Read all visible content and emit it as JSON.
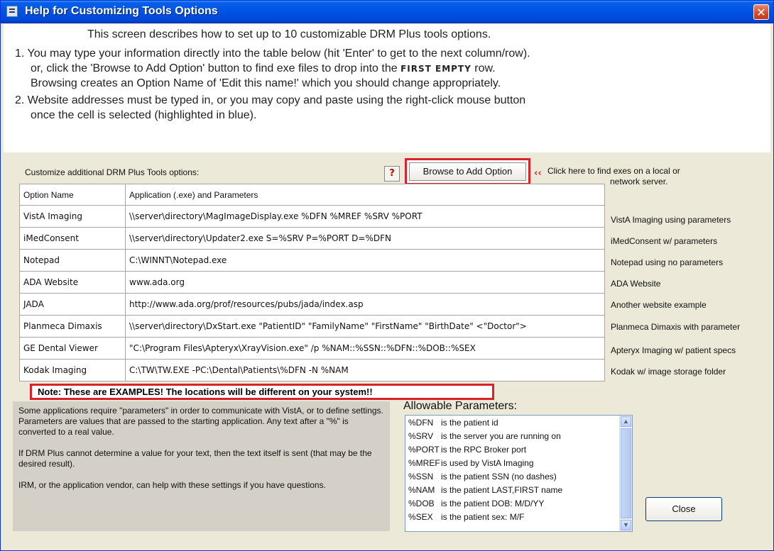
{
  "window": {
    "title": "Help for Customizing Tools Options",
    "close_glyph": "✕"
  },
  "intro": {
    "line1": "This screen describes how to set up to 10 customizable DRM Plus tools options.",
    "line2": "1. You may type your information directly into the table below (hit 'Enter' to get to the next column/row).",
    "line3_pre": "or, click the 'Browse to Add Option' button to find exe files to drop into the",
    "line3_bold": "FIRST EMPTY",
    "line3_post": "row.",
    "line4": "Browsing creates an Option Name of 'Edit this name!' which you should change appropriately.",
    "line5": "2. Website addresses must be typed in, or you may copy and paste using the right-click mouse button",
    "line6": "once the cell is selected (highlighted in blue)."
  },
  "panel": {
    "label": "Customize additional DRM Plus Tools options:",
    "help_glyph": "?",
    "browse_label": "Browse to Add Option",
    "arrows": "‹‹",
    "side_note_line1": "Click here to find exes on a local or",
    "side_note_line2": "network server."
  },
  "table": {
    "headers": [
      "Option Name",
      "Application (.exe) and Parameters"
    ],
    "rows": [
      {
        "name": "VistA Imaging",
        "app": "\\\\server\\directory\\MagImageDisplay.exe %DFN %MREF %SRV %PORT",
        "desc": "VistA Imaging using parameters"
      },
      {
        "name": "iMedConsent",
        "app": "\\\\server\\directory\\Updater2.exe S=%SRV P=%PORT D=%DFN",
        "desc": "iMedConsent w/ parameters"
      },
      {
        "name": "Notepad",
        "app": "C:\\WINNT\\Notepad.exe",
        "desc": "Notepad using no parameters"
      },
      {
        "name": "ADA Website",
        "app": "www.ada.org",
        "desc": "ADA Website"
      },
      {
        "name": "JADA",
        "app": "http://www.ada.org/prof/resources/pubs/jada/index.asp",
        "desc": "Another website example"
      },
      {
        "name": "Planmeca Dimaxis",
        "app": "\\\\server\\directory\\DxStart.exe \"PatientID\" \"FamilyName\" \"FirstName\" \"BirthDate\" <\"Doctor\">",
        "desc": "Planmeca Dimaxis with parameter"
      },
      {
        "name": "GE Dental Viewer",
        "app": "\"C:\\Program Files\\Apteryx\\XrayVision.exe\" /p %NAM::%SSN::%DFN::%DOB::%SEX",
        "desc": "Apteryx Imaging w/ patient specs"
      },
      {
        "name": "Kodak Imaging",
        "app": "C:\\TW\\TW.EXE -PC:\\Dental\\Patients\\%DFN -N %NAM",
        "desc": "Kodak w/ image storage folder"
      }
    ]
  },
  "note": "Note: These are EXAMPLES!  The locations will be different on your system!!",
  "gray_panel": {
    "p1": "Some applications require \"parameters\" in order to communicate with VistA, or to define settings.  Parameters are values that are passed to the starting application.  Any text after a \"%\" is converted to a real value.",
    "p2": "If DRM Plus cannot determine a value for your text, then the text itself is sent (that may be the desired result).",
    "p3": "IRM, or the application vendor, can help with these settings if you have questions."
  },
  "params": {
    "title": "Allowable Parameters:",
    "items": [
      {
        "code": "%DFN",
        "desc": "is the patient id"
      },
      {
        "code": "%SRV",
        "desc": "is the server you are running on"
      },
      {
        "code": "%PORT",
        "desc": "is the RPC Broker port"
      },
      {
        "code": "%MREF",
        "desc": "is used by VistA Imaging"
      },
      {
        "code": "%SSN",
        "desc": "is the patient SSN (no dashes)"
      },
      {
        "code": "%NAM",
        "desc": "is the patient LAST,FIRST name"
      },
      {
        "code": "%DOB",
        "desc": "is the patient DOB: M/D/YY"
      },
      {
        "code": "%SEX",
        "desc": "is the patient sex: M/F"
      }
    ],
    "scroll_up": "▲",
    "scroll_down": "▼"
  },
  "close_label": "Close"
}
